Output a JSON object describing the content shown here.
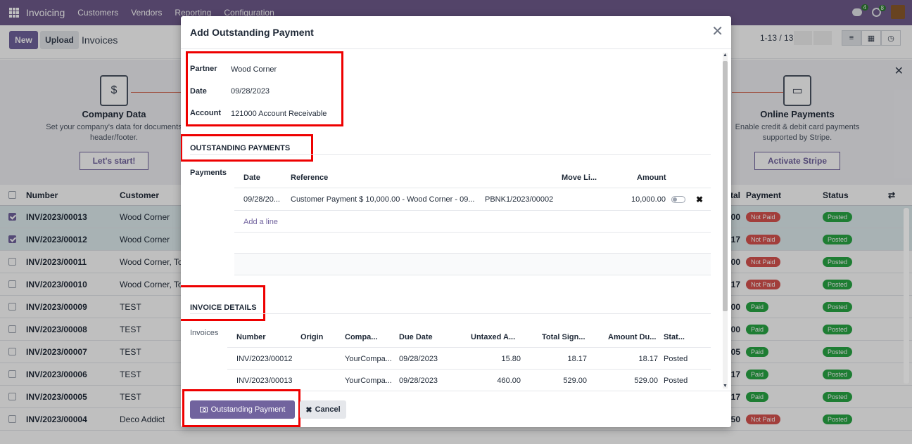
{
  "topbar": {
    "app": "Invoicing",
    "menu": [
      "Customers",
      "Vendors",
      "Reporting",
      "Configuration"
    ],
    "chat_count": "4",
    "activity_count": "8"
  },
  "control": {
    "new_label": "New",
    "upload_label": "Upload",
    "breadcrumb": "Invoices",
    "pager": "1-13 / 13"
  },
  "onboarding": {
    "company": {
      "title": "Company Data",
      "text": "Set your company's data for documents header/footer.",
      "button": "Let's start!"
    },
    "online": {
      "title": "Online Payments",
      "text": "Enable credit & debit card payments supported by Stripe.",
      "button": "Activate Stripe"
    }
  },
  "list": {
    "headers": {
      "number": "Number",
      "customer": "Customer",
      "total": "tal",
      "payment": "Payment",
      "status": "Status"
    },
    "rows": [
      {
        "number": "INV/2023/00013",
        "customer": "Wood Corner",
        "total": "00",
        "payment": "Not Paid",
        "status": "Posted"
      },
      {
        "number": "INV/2023/00012",
        "customer": "Wood Corner",
        "total": "17",
        "payment": "Not Paid",
        "status": "Posted"
      },
      {
        "number": "INV/2023/00011",
        "customer": "Wood Corner, To",
        "total": "00",
        "payment": "Not Paid",
        "status": "Posted"
      },
      {
        "number": "INV/2023/00010",
        "customer": "Wood Corner, To",
        "total": "17",
        "payment": "Not Paid",
        "status": "Posted"
      },
      {
        "number": "INV/2023/00009",
        "customer": "TEST",
        "total": "00",
        "payment": "Paid",
        "status": "Posted"
      },
      {
        "number": "INV/2023/00008",
        "customer": "TEST",
        "total": "00",
        "payment": "Paid",
        "status": "Posted"
      },
      {
        "number": "INV/2023/00007",
        "customer": "TEST",
        "total": "05",
        "payment": "Paid",
        "status": "Posted"
      },
      {
        "number": "INV/2023/00006",
        "customer": "TEST",
        "total": "17",
        "payment": "Paid",
        "status": "Posted"
      },
      {
        "number": "INV/2023/00005",
        "customer": "TEST",
        "total": "17",
        "payment": "Paid",
        "status": "Posted"
      },
      {
        "number": "INV/2023/00004",
        "customer": "Deco Addict",
        "total": "50",
        "payment": "Not Paid",
        "status": "Posted"
      }
    ]
  },
  "modal": {
    "title": "Add Outstanding Payment",
    "fields": {
      "partner_label": "Partner",
      "partner": "Wood Corner",
      "date_label": "Date",
      "date": "09/28/2023",
      "account_label": "Account",
      "account": "121000 Account Receivable"
    },
    "outstanding": {
      "section": "OUTSTANDING PAYMENTS",
      "label": "Payments",
      "headers": {
        "date": "Date",
        "reference": "Reference",
        "move_line": "Move Li...",
        "amount": "Amount"
      },
      "row": {
        "date": "09/28/20...",
        "reference": "Customer Payment $ 10,000.00 - Wood Corner - 09...",
        "move_line": "PBNK1/2023/00002",
        "amount": "10,000.00"
      },
      "add_line": "Add a line"
    },
    "invoice_details": {
      "section": "INVOICE DETAILS",
      "label": "Invoices",
      "headers": {
        "number": "Number",
        "origin": "Origin",
        "company": "Compa...",
        "due": "Due Date",
        "untaxed": "Untaxed A...",
        "total": "Total Sign...",
        "amount_due": "Amount Du...",
        "status": "Stat..."
      },
      "rows": [
        {
          "number": "INV/2023/00012",
          "company": "YourCompa...",
          "due": "09/28/2023",
          "untaxed": "15.80",
          "total": "18.17",
          "amount_due": "18.17",
          "status": "Posted"
        },
        {
          "number": "INV/2023/00013",
          "company": "YourCompa...",
          "due": "09/28/2023",
          "untaxed": "460.00",
          "total": "529.00",
          "amount_due": "529.00",
          "status": "Posted"
        }
      ]
    },
    "footer": {
      "primary": "Outstanding Payment",
      "cancel": "Cancel"
    }
  }
}
